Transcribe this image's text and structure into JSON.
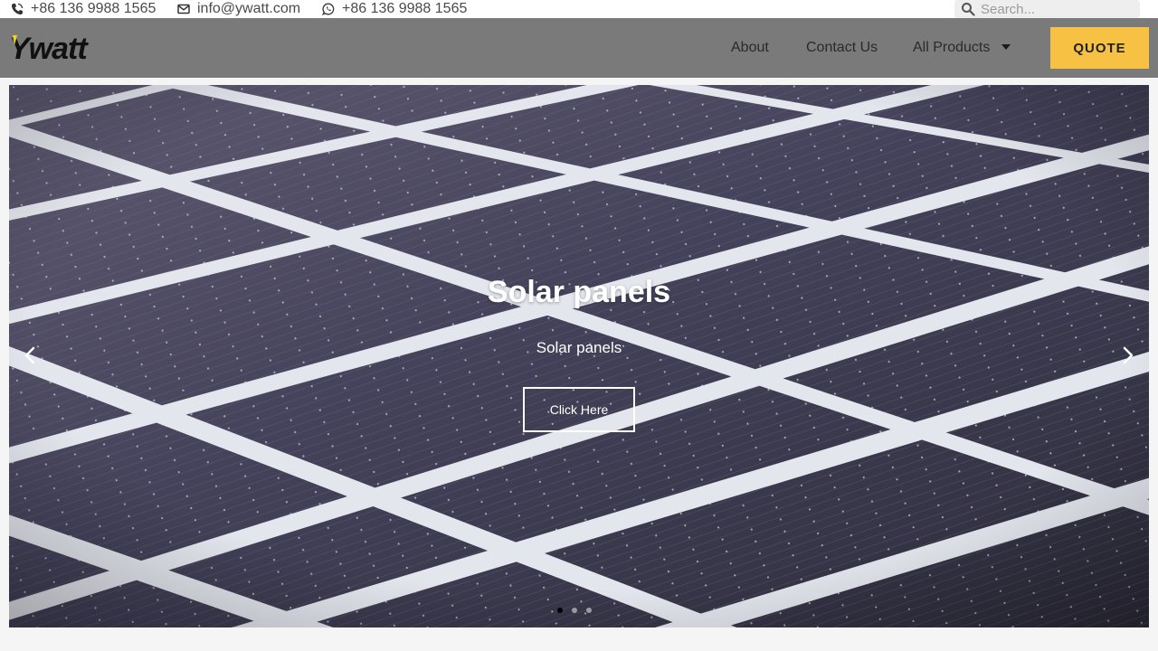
{
  "topbar": {
    "phone": "+86 136 9988 1565",
    "email": "info@ywatt.com",
    "whatsapp": "+86 136 9988 1565",
    "search_placeholder": "Search..."
  },
  "header": {
    "logo_text": "Ywatt",
    "nav": {
      "about": "About",
      "contact": "Contact Us",
      "products": "All Products"
    },
    "quote_label": "QUOTE"
  },
  "hero": {
    "title": "Solar panels",
    "subtitle": "Solar panels",
    "button_label": "Click Here",
    "slide_count": 3,
    "active_slide": 1
  },
  "colors": {
    "header_bg": "#7a7a7a",
    "quote_bg": "#f7c244",
    "panel_cell": "#3b3a4a",
    "grid_line": "#e4e6ee"
  },
  "icons": [
    "phone-icon",
    "email-icon",
    "whatsapp-icon",
    "search-icon",
    "chevron-left-icon",
    "chevron-right-icon",
    "chevron-down-icon"
  ]
}
